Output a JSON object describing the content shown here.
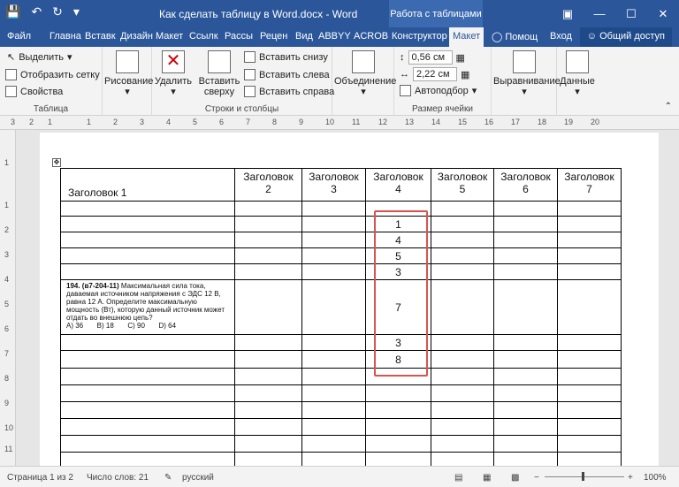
{
  "titlebar": {
    "title": "Как сделать таблицу в Word.docx - Word",
    "context_tab": "Работа с таблицами",
    "qat": [
      "save-icon",
      "undo-icon",
      "redo-icon",
      "customize-icon"
    ]
  },
  "tabs": [
    "Файл",
    "Главна",
    "Вставк",
    "Дизайн",
    "Макет",
    "Ссылк",
    "Рассы",
    "Рецен",
    "Вид",
    "ABBYY",
    "ACROB",
    "Конструктор",
    "Макет"
  ],
  "tabs_right": {
    "help": "Помощ",
    "signin": "Вход",
    "share": "Общий доступ"
  },
  "ribbon": {
    "table": {
      "select": "Выделить",
      "gridlines": "Отобразить сетку",
      "properties": "Свойства",
      "label": "Таблица"
    },
    "draw": {
      "label": "Рисование"
    },
    "delete": {
      "label": "Удалить"
    },
    "insert_above": {
      "line1": "Вставить",
      "line2": "сверху"
    },
    "insert": {
      "below": "Вставить снизу",
      "left": "Вставить слева",
      "right": "Вставить справа"
    },
    "rows_cols_label": "Строки и столбцы",
    "merge": {
      "label": "Объединение"
    },
    "size": {
      "height": "0,56 см",
      "width": "2,22 см",
      "autofit": "Автоподбор",
      "label": "Размер ячейки"
    },
    "align": {
      "label": "Выравнивание"
    },
    "data": {
      "label": "Данные"
    }
  },
  "ruler": {
    "numbers": [
      "3",
      "2",
      "1",
      "1",
      "2",
      "3",
      "4",
      "5",
      "6",
      "7",
      "8",
      "9",
      "10",
      "11",
      "12",
      "13",
      "14",
      "15",
      "16",
      "17",
      "18",
      "19",
      "20"
    ]
  },
  "vruler": {
    "numbers": [
      "1",
      "1",
      "2",
      "3",
      "4",
      "5",
      "6",
      "7",
      "8",
      "9",
      "10",
      "11",
      "12"
    ]
  },
  "table": {
    "headers": [
      {
        "l1": "",
        "l2": "Заголовок 1"
      },
      {
        "l1": "Заголовок",
        "l2": "2"
      },
      {
        "l1": "Заголовок",
        "l2": "3"
      },
      {
        "l1": "Заголовок",
        "l2": "4"
      },
      {
        "l1": "Заголовок",
        "l2": "5"
      },
      {
        "l1": "Заголовок",
        "l2": "6"
      },
      {
        "l1": "Заголовок",
        "l2": "7"
      }
    ],
    "col4_values": [
      "",
      "1",
      "4",
      "5",
      "3",
      "7",
      "3",
      "8",
      "",
      "",
      "",
      "",
      "",
      ""
    ],
    "question": {
      "head": "194. (в7-204-11)",
      "text": "Максимальная сила тока, даваемая источником напряжения с ЭДС 12 В, равна 12 А. Определите максимальную мощность (Вт), которую данный источник может отдать во внешнюю цепь?",
      "options": "A) 36       B) 18       C) 90       D) 64"
    }
  },
  "status": {
    "page": "Страница 1 из 2",
    "words": "Число слов: 21",
    "lang": "русский",
    "zoom": "100%"
  }
}
